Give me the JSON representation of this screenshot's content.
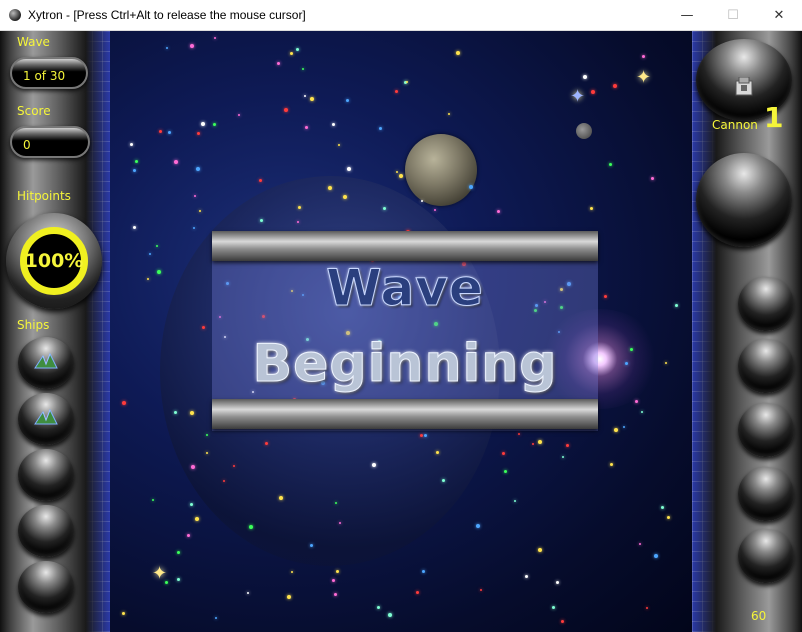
{
  "window": {
    "title": "Xytron - [Press Ctrl+Alt to release the mouse cursor]",
    "minimize_glyph": "—",
    "maximize_glyph": "☐",
    "close_glyph": "✕"
  },
  "hud": {
    "wave_label": "Wave",
    "wave_value": "1 of 30",
    "score_label": "Score",
    "score_value": "0",
    "hitpoints_label": "Hitpoints",
    "hitpoints_value": "100%",
    "hitpoints_fraction": 1.0,
    "ships_label": "Ships",
    "ships_remaining": 2,
    "ship_slots": 5,
    "cannon_label": "Cannon",
    "cannon_value": "1",
    "weapon_slots": 5,
    "fps_value": "60"
  },
  "banner": {
    "line1": "Wave",
    "line2": "Beginning"
  },
  "colors": {
    "hud_text": "#f5f53a",
    "grid_blue": "#2b3aa8",
    "space_dark": "#060c2c"
  }
}
